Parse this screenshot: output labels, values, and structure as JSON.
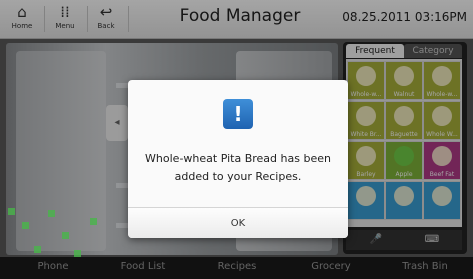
{
  "topbar": {
    "home_label": "Home",
    "menu_label": "Menu",
    "back_label": "Back",
    "title": "Food Manager",
    "datetime": "08.25.2011 03:16PM"
  },
  "panel": {
    "tabs": [
      "Frequent",
      "Category"
    ],
    "items": [
      "Whole-w...",
      "Walnut",
      "Whole-w...",
      "White Br...",
      "Baguette",
      "Whole W...",
      "Barley",
      "Apple",
      "Beef Fat",
      "",
      "",
      ""
    ]
  },
  "bottom_nav": [
    "Phone",
    "Food List",
    "Recipes",
    "Grocery",
    "Trash Bin"
  ],
  "dialog": {
    "message_line1": "Whole-wheat Pita Bread has been",
    "message_line2": "added to your Recipes.",
    "ok_label": "OK"
  },
  "colors": {
    "tile_green": "#a8b03a",
    "dialog_icon_blue": "#2a76c6"
  }
}
